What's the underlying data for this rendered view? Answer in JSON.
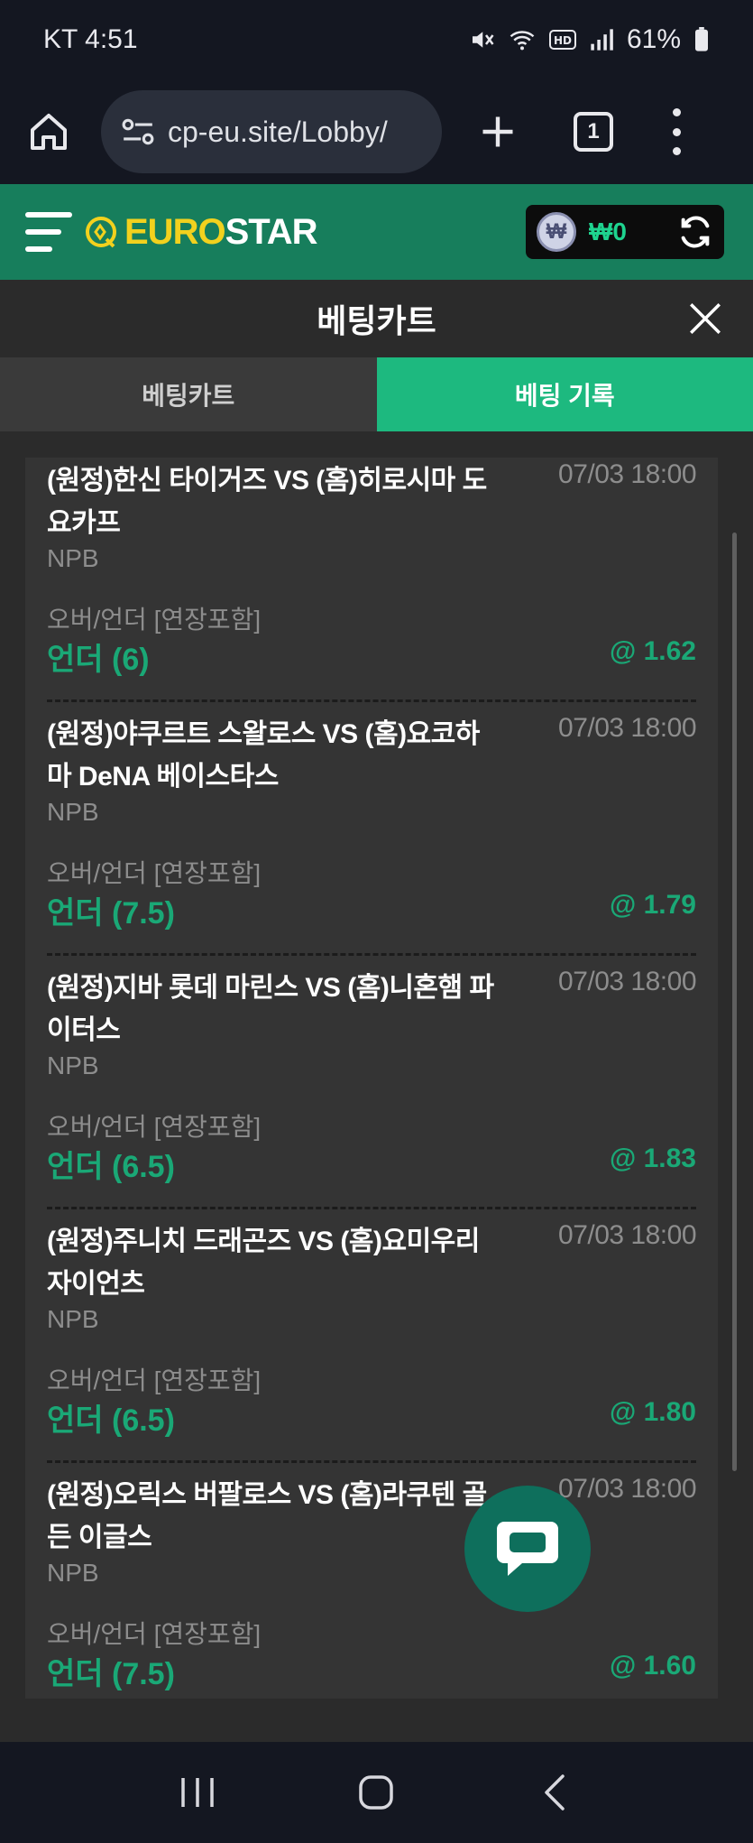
{
  "status_bar": {
    "carrier_time": "KT 4:51",
    "battery": "61%"
  },
  "browser": {
    "url": "cp-eu.site/Lobby/",
    "tab_count": "1"
  },
  "site": {
    "logo_euro": "EURO",
    "logo_star": "STAR",
    "wallet_balance": "₩0",
    "won_symbol": "₩"
  },
  "cart": {
    "title": "베팅카트",
    "tabs": [
      {
        "label": "베팅카트",
        "active": false
      },
      {
        "label": "베팅 기록",
        "active": true
      }
    ]
  },
  "bets": [
    {
      "teams": "(원정)한신 타이거즈 VS (홈)히로시마 도요카프",
      "datetime": "07/03 18:00",
      "league": "NPB",
      "market": "오버/언더 [연장포함]",
      "pick": "언더 (6)",
      "odds": "@ 1.62"
    },
    {
      "teams": "(원정)야쿠르트 스왈로스 VS (홈)요코하마 DeNA 베이스타스",
      "datetime": "07/03 18:00",
      "league": "NPB",
      "market": "오버/언더 [연장포함]",
      "pick": "언더 (7.5)",
      "odds": "@ 1.79"
    },
    {
      "teams": "(원정)지바 롯데 마린스 VS (홈)니혼햄 파이터스",
      "datetime": "07/03 18:00",
      "league": "NPB",
      "market": "오버/언더 [연장포함]",
      "pick": "언더 (6.5)",
      "odds": "@ 1.83"
    },
    {
      "teams": "(원정)주니치 드래곤즈 VS (홈)요미우리 자이언츠",
      "datetime": "07/03 18:00",
      "league": "NPB",
      "market": "오버/언더 [연장포함]",
      "pick": "언더 (6.5)",
      "odds": "@ 1.80"
    },
    {
      "teams": "(원정)오릭스 버팔로스 VS (홈)라쿠텐 골든 이글스",
      "datetime": "07/03 18:00",
      "league": "NPB",
      "market": "오버/언더 [연장포함]",
      "pick": "언더 (7.5)",
      "odds": "@ 1.60"
    }
  ]
}
